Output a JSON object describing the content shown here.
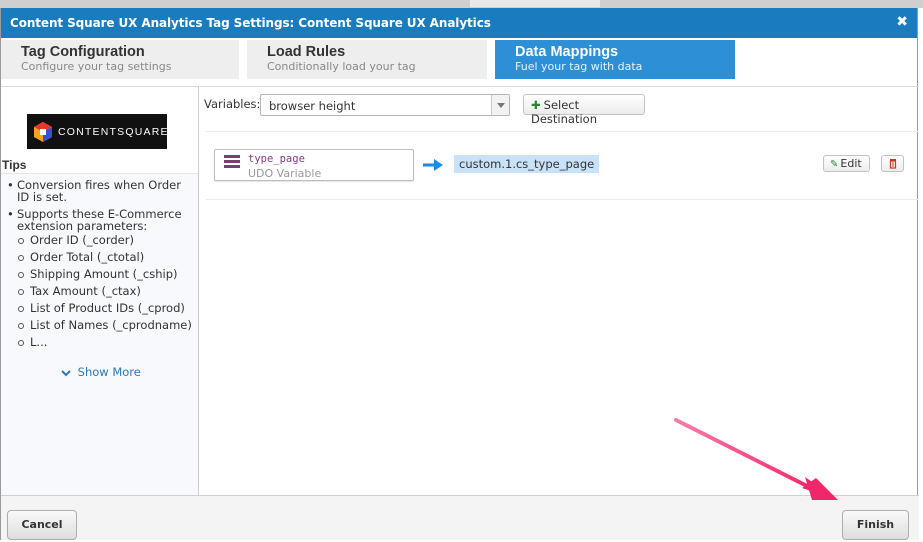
{
  "dialog": {
    "title": "Content Square UX Analytics Tag Settings: Content Square UX Analytics",
    "close_icon": "close-x-icon",
    "title_color": "#1a7bbd"
  },
  "tabs": [
    {
      "label": "Tag Configuration",
      "subtitle": "Configure your tag settings",
      "active": false
    },
    {
      "label": "Load Rules",
      "subtitle": "Conditionally load your tag",
      "active": false
    },
    {
      "label": "Data Mappings",
      "subtitle": "Fuel your tag with data",
      "active": true
    }
  ],
  "sidebar": {
    "logo_text": "CONTENTSQUARE",
    "tips_heading": "Tips",
    "tips": [
      "Conversion fires when Order ID is set.",
      "Supports these E-Commerce extension parameters:"
    ],
    "params": [
      "Order ID (_corder)",
      "Order Total (_ctotal)",
      "Shipping Amount (_cship)",
      "Tax Amount (_ctax)",
      "List of Product IDs (_cprod)",
      "List of Names (_cprodname)",
      "L..."
    ],
    "show_more": "Show More"
  },
  "toolbar": {
    "variables_label": "Variables:",
    "variable_selected": "browser height",
    "select_destination": "Select Destination"
  },
  "mapping": {
    "variable_name": "type_page",
    "variable_type": "UDO Variable",
    "destination": "custom.1.cs_type_page",
    "edit_label": "Edit"
  },
  "footer": {
    "cancel": "Cancel",
    "finish": "Finish"
  },
  "colors": {
    "accent": "#2d8fd5",
    "annotation_arrow": "#f0276a",
    "variable_color": "#8b3b87"
  }
}
